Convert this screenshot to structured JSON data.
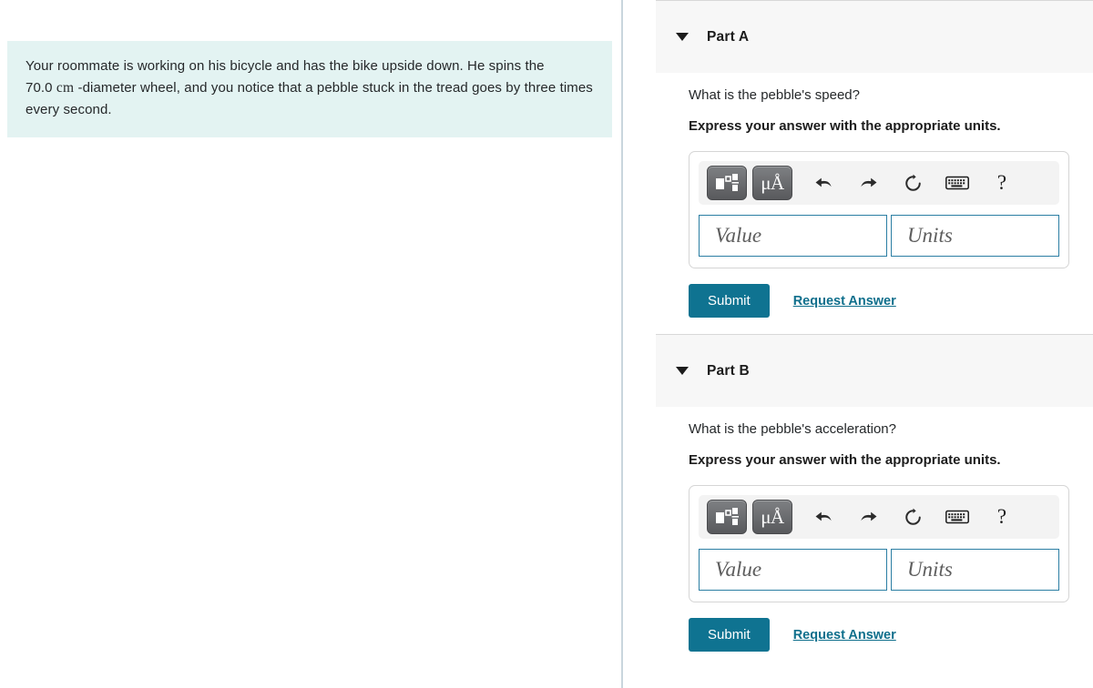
{
  "problem": {
    "text_before_unit": "Your roommate is working on his bicycle and has the bike upside down. He spins the ",
    "value": "70.0",
    "unit": "cm",
    "text_after_unit": "-diameter wheel, and you notice that a pebble stuck in the tread goes by three times every second."
  },
  "colors": {
    "problem_box_bg": "#e3f3f2",
    "submit_bg": "#0f7391",
    "link": "#0f6f8c",
    "field_border": "#2b7ea3",
    "header_bg": "#f7f7f7",
    "toolbar_bg": "#f3f3f3"
  },
  "toolbar": {
    "template_button_name": "math-template-button",
    "units_button_label": "μÅ",
    "undo_label": "undo",
    "redo_label": "redo",
    "reset_label": "reset",
    "keyboard_label": "keyboard",
    "help_label": "?"
  },
  "answer_fields": {
    "value_placeholder": "Value",
    "units_placeholder": "Units",
    "value_current": "",
    "units_current": ""
  },
  "actions": {
    "submit_label": "Submit",
    "request_answer_label": "Request Answer"
  },
  "parts": [
    {
      "id": "a",
      "label": "Part A",
      "question": "What is the pebble's speed?",
      "instruction": "Express your answer with the appropriate units."
    },
    {
      "id": "b",
      "label": "Part B",
      "question": "What is the pebble's acceleration?",
      "instruction": "Express your answer with the appropriate units."
    }
  ]
}
